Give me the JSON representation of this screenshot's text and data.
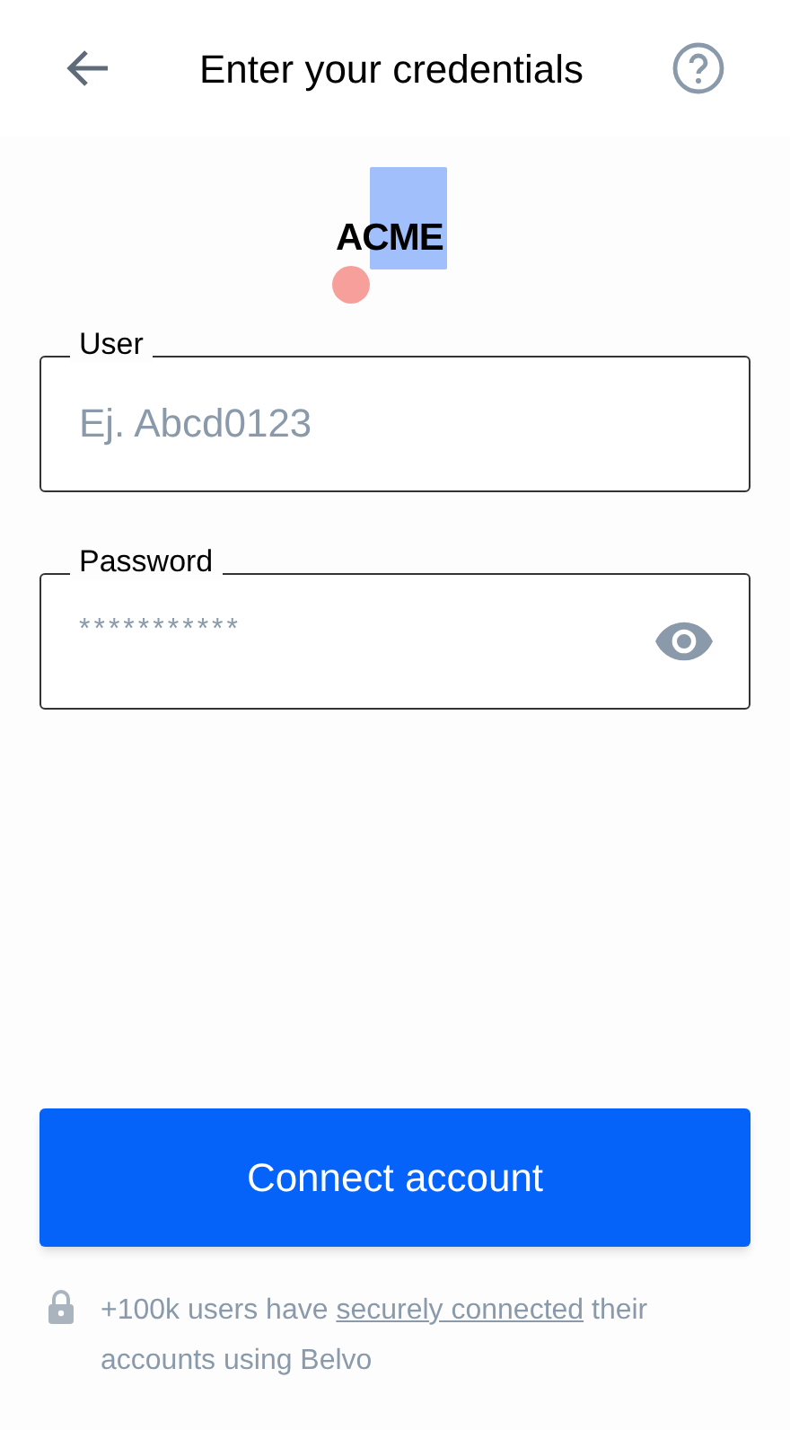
{
  "header": {
    "title": "Enter your credentials"
  },
  "logo": {
    "text": "ACME"
  },
  "fields": [
    {
      "kind": "text",
      "label": "User",
      "placeholder": "Ej. Abcd0123"
    },
    {
      "kind": "password",
      "label": "Password",
      "placeholder": "***********"
    }
  ],
  "button": {
    "label": "Connect account"
  },
  "footer": {
    "before": "+100k users have ",
    "link": "securely connected",
    "after": " their accounts using Belvo"
  }
}
